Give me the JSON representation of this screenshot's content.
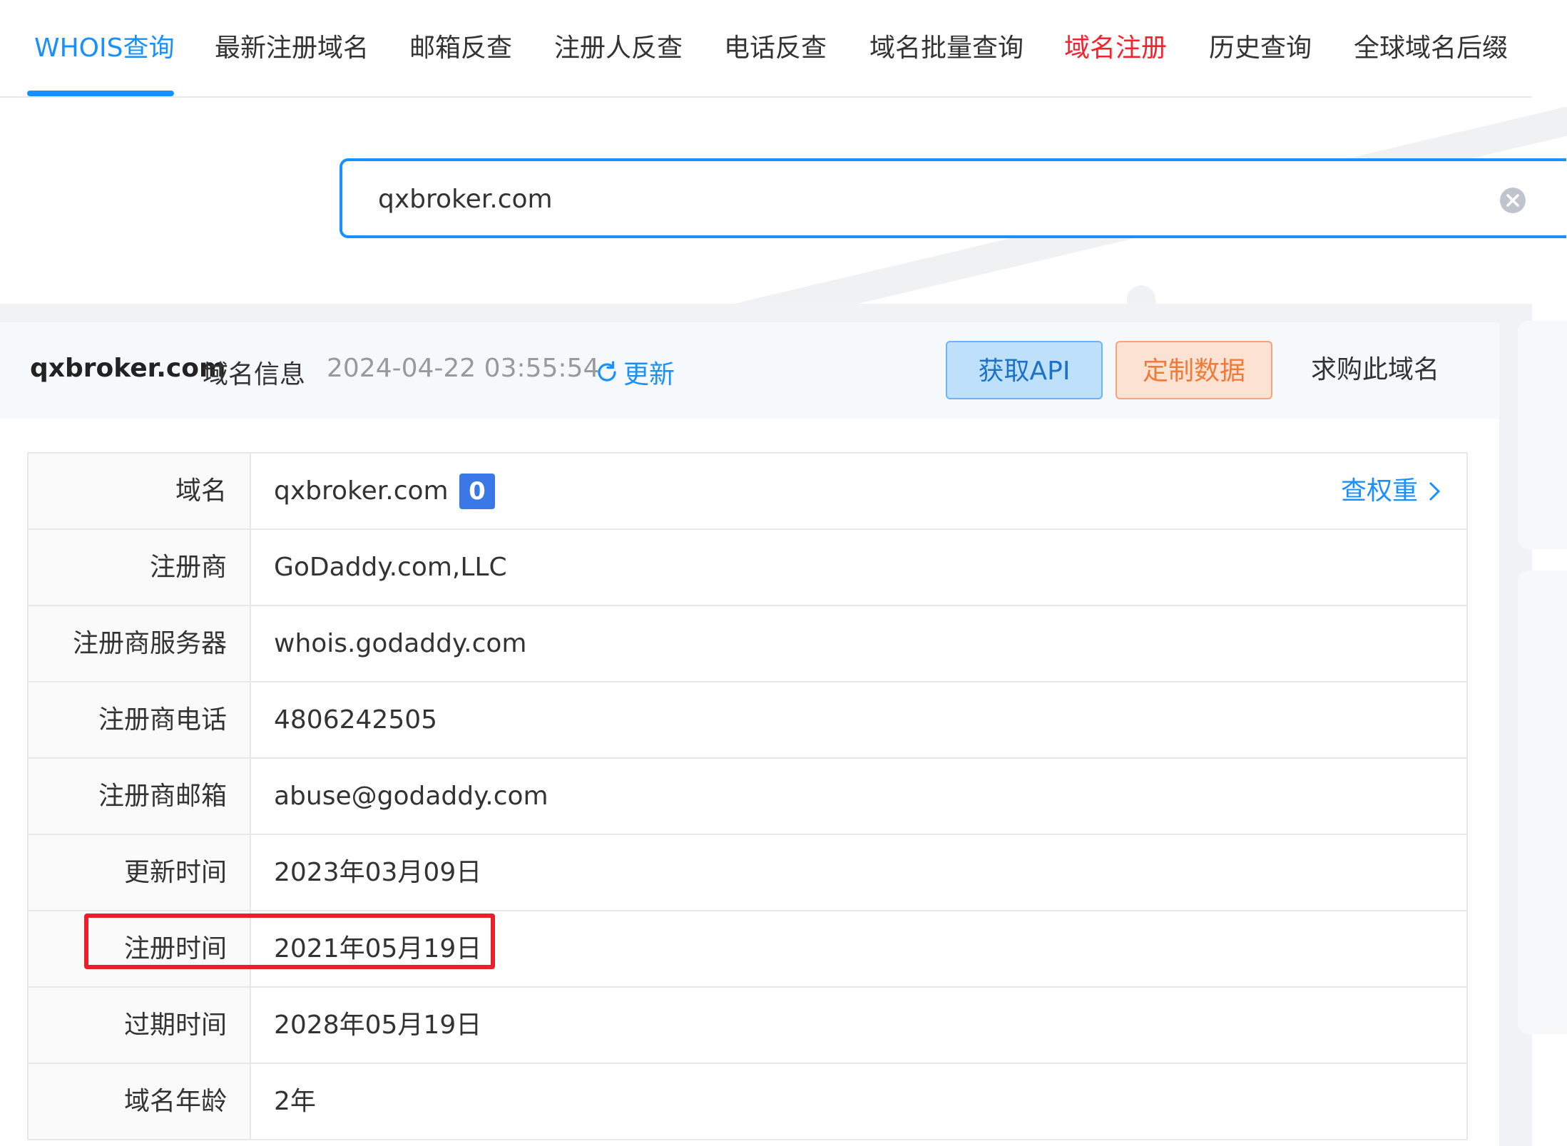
{
  "nav": {
    "tabs": [
      {
        "label": "WHOIS查询"
      },
      {
        "label": "最新注册域名"
      },
      {
        "label": "邮箱反查"
      },
      {
        "label": "注册人反查"
      },
      {
        "label": "电话反查"
      },
      {
        "label": "域名批量查询"
      },
      {
        "label": "域名注册"
      },
      {
        "label": "历史查询"
      },
      {
        "label": "全球域名后缀"
      }
    ],
    "active_color": "#1890ff",
    "highlight_color": "#f5222d"
  },
  "search": {
    "value": "qxbroker.com"
  },
  "header": {
    "domain": "qxbroker.com",
    "suffix": "域名信息",
    "timestamp": "2024-04-22 03:55:54",
    "refresh_label": "更新",
    "api_label": "获取API",
    "custom_label": "定制数据",
    "buy_label": "求购此域名"
  },
  "rows": [
    {
      "label": "域名",
      "value": "qxbroker.com",
      "badge": "0",
      "link": "查权重"
    },
    {
      "label": "注册商",
      "value": "GoDaddy.com,LLC"
    },
    {
      "label": "注册商服务器",
      "value": "whois.godaddy.com"
    },
    {
      "label": "注册商电话",
      "value": "4806242505"
    },
    {
      "label": "注册商邮箱",
      "value": "abuse@godaddy.com"
    },
    {
      "label": "更新时间",
      "value": "2023年03月09日"
    },
    {
      "label": "注册时间",
      "value": "2021年05月19日"
    },
    {
      "label": "过期时间",
      "value": "2028年05月19日"
    },
    {
      "label": "域名年龄",
      "value": "2年"
    }
  ],
  "icons": {
    "clear": "close-circle-icon",
    "refresh": "refresh-icon",
    "chevron": "chevron-right-icon"
  },
  "highlight_color": "#e8202a"
}
